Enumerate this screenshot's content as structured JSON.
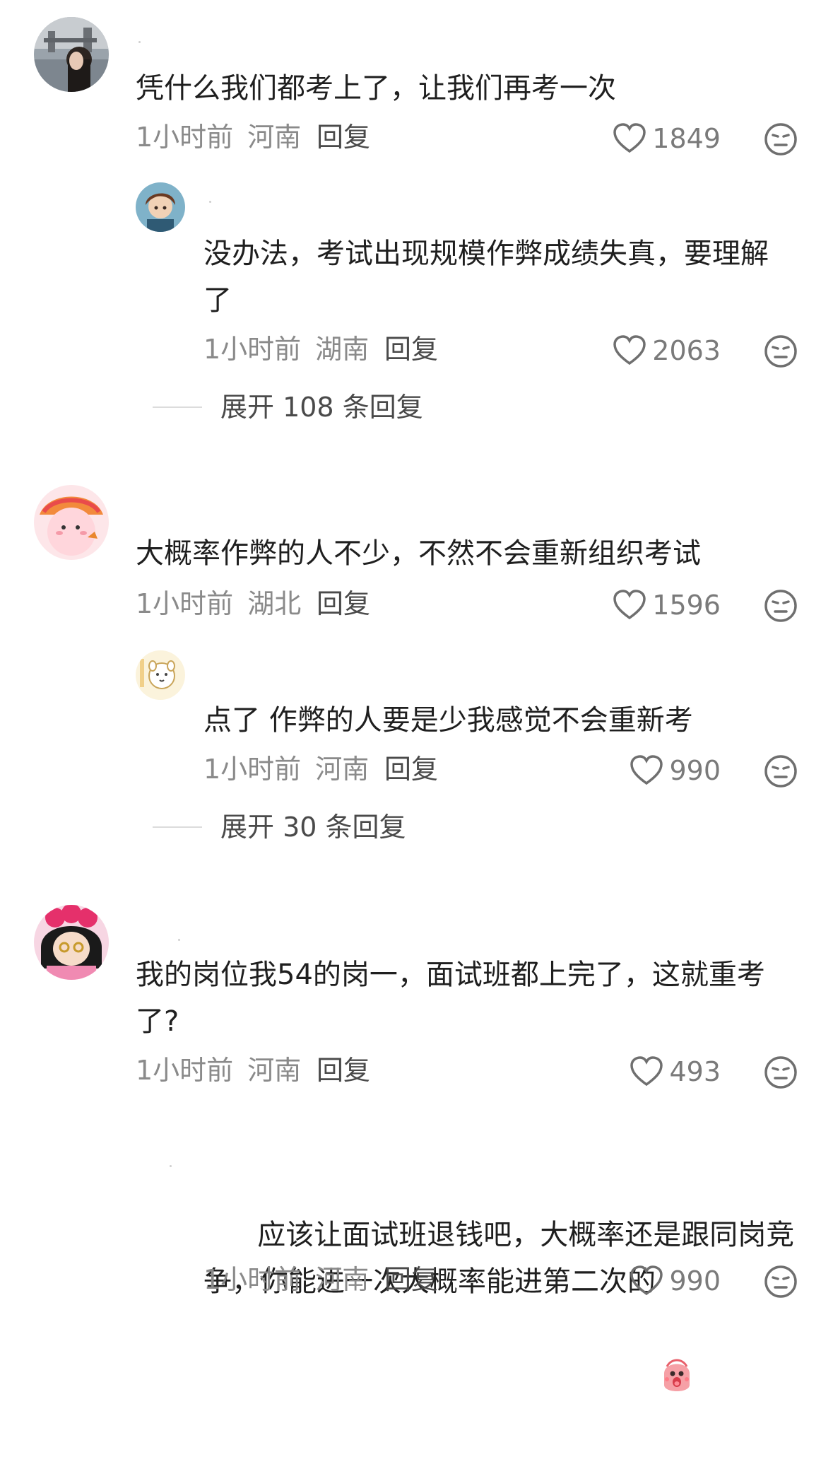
{
  "comments": [
    {
      "text": "凭什么我们都考上了，让我们再考一次",
      "time": "1小时前",
      "location": "河南",
      "reply_label": "回复",
      "likes": "1849",
      "replies": [
        {
          "text": "没办法，考试出现规模作弊成绩失真，要理解\n了",
          "time": "1小时前",
          "location": "湖南",
          "reply_label": "回复",
          "likes": "2063"
        }
      ],
      "expand_label": "展开 108 条回复"
    },
    {
      "text": "大概率作弊的人不少，不然不会重新组织考试",
      "time": "1小时前",
      "location": "湖北",
      "reply_label": "回复",
      "likes": "1596",
      "replies": [
        {
          "text": "点了 作弊的人要是少我感觉不会重新考",
          "time": "1小时前",
          "location": "河南",
          "reply_label": "回复",
          "likes": "990"
        }
      ],
      "expand_label": "展开 30 条回复"
    },
    {
      "text": "我的岗位我54的岗一，面试班都上完了，这就重考\n了?",
      "time": "1小时前",
      "location": "河南",
      "reply_label": "回复",
      "likes": "493",
      "replies": [
        {
          "text": "应该让面试班退钱吧，大概率还是跟同岗竞\n争，你能进一次大概率能进第二次的",
          "time": "1小时前",
          "location": "河南",
          "reply_label": "回复",
          "likes": "990"
        }
      ]
    }
  ],
  "icons": {
    "like": "heart-outline-icon",
    "dislike": "neutral-face-icon",
    "emoji": "surprised-emoji-icon"
  },
  "colors": {
    "meta_text": "#8a8a8a",
    "body_text": "#1f1f1f",
    "reply_text": "#4a4a4a"
  }
}
